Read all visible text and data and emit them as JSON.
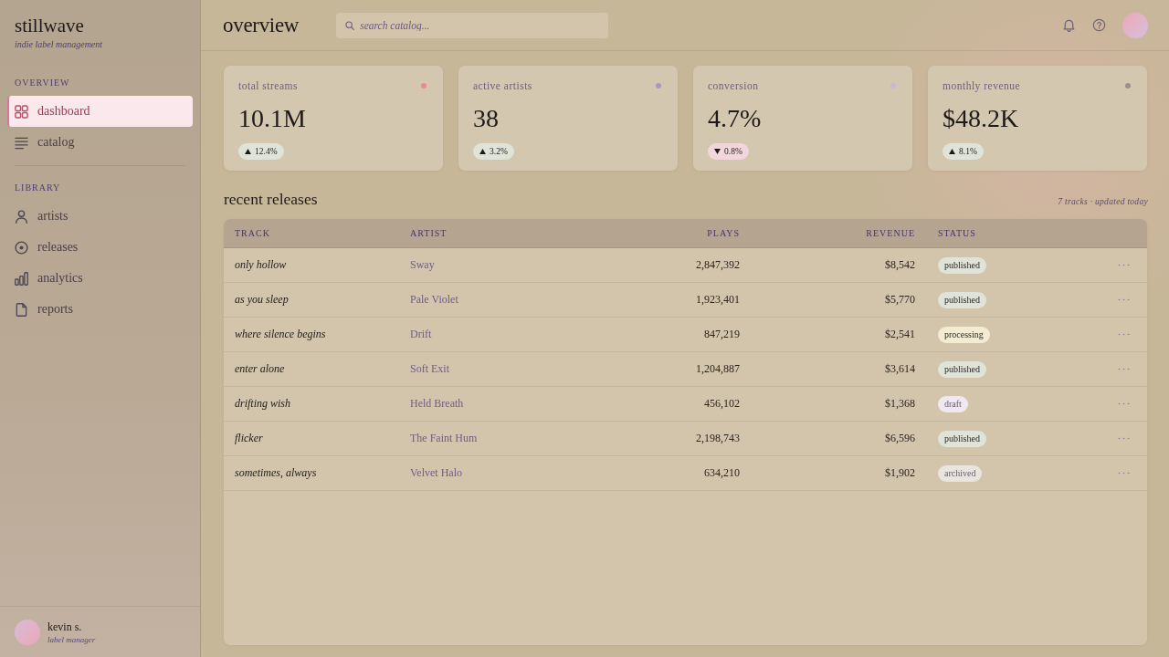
{
  "sidebar": {
    "brand": "stillwave",
    "tagline": "indie label management",
    "sections": [
      {
        "heading": "OVERVIEW",
        "items": [
          {
            "label": "dashboard",
            "selected": true
          },
          {
            "label": "catalog",
            "selected": false
          }
        ]
      },
      {
        "heading": "LIBRARY",
        "items": [
          {
            "label": "artists",
            "selected": false
          },
          {
            "label": "releases",
            "selected": false
          },
          {
            "label": "analytics",
            "selected": false
          },
          {
            "label": "reports",
            "selected": false
          }
        ]
      }
    ],
    "user": {
      "name": "kevin s.",
      "role": "label manager"
    }
  },
  "header": {
    "title": "overview",
    "search": {
      "placeholder": "search catalog..."
    }
  },
  "stats": [
    {
      "label": "total streams",
      "value": "10.1M",
      "change": "12.4%",
      "rising": true,
      "color": "#e8899a"
    },
    {
      "label": "active artists",
      "value": "38",
      "change": "3.2%",
      "rising": true,
      "color": "#a898c4"
    },
    {
      "label": "conversion",
      "value": "4.7%",
      "change": "0.8%",
      "rising": false,
      "color": "#c8b8d8"
    },
    {
      "label": "monthly revenue",
      "value": "$48.2K",
      "change": "8.1%",
      "rising": true,
      "color": "#9a928a"
    }
  ],
  "releases": {
    "title": "recent releases",
    "meta": "7 tracks · updated today",
    "columns": [
      "TRACK",
      "ARTIST",
      "PLAYS",
      "REVENUE",
      "STATUS"
    ],
    "rows": [
      {
        "track": "only hollow",
        "artist": "Sway",
        "plays": "2,847,392",
        "revenue": "$8,542",
        "status": {
          "label": "published",
          "color": "#dfe3d8",
          "muted": false
        }
      },
      {
        "track": "as you sleep",
        "artist": "Pale Violet",
        "plays": "1,923,401",
        "revenue": "$5,770",
        "status": {
          "label": "published",
          "color": "#dfe3d8",
          "muted": false
        }
      },
      {
        "track": "where silence begins",
        "artist": "Drift",
        "plays": "847,219",
        "revenue": "$2,541",
        "status": {
          "label": "processing",
          "color": "#f3ebd2",
          "muted": false
        }
      },
      {
        "track": "enter alone",
        "artist": "Soft Exit",
        "plays": "1,204,887",
        "revenue": "$3,614",
        "status": {
          "label": "published",
          "color": "#dfe3d8",
          "muted": false
        }
      },
      {
        "track": "drifting wish",
        "artist": "Held Breath",
        "plays": "456,102",
        "revenue": "$1,368",
        "status": {
          "label": "draft",
          "color": "#efe8f0",
          "muted": true
        }
      },
      {
        "track": "flicker",
        "artist": "The Faint Hum",
        "plays": "2,198,743",
        "revenue": "$6,596",
        "status": {
          "label": "published",
          "color": "#dfe3d8",
          "muted": false
        }
      },
      {
        "track": "sometimes, always",
        "artist": "Velvet Halo",
        "plays": "634,210",
        "revenue": "$1,902",
        "status": {
          "label": "archived",
          "color": "#e8e4de",
          "muted": true
        }
      }
    ]
  }
}
